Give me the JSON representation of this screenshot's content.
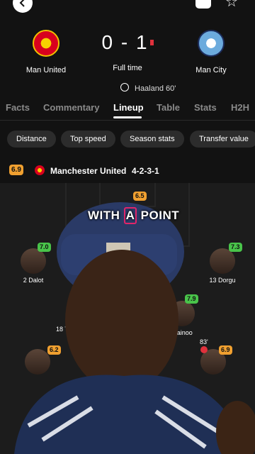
{
  "header": {
    "home_team": "Man United",
    "away_team": "Man City",
    "score": "0 - 1",
    "status": "Full time",
    "scorer": "Haaland 60'"
  },
  "tabs": [
    {
      "label": "Facts",
      "active": false
    },
    {
      "label": "Commentary",
      "active": false
    },
    {
      "label": "Lineup",
      "active": true
    },
    {
      "label": "Table",
      "active": false
    },
    {
      "label": "Stats",
      "active": false
    },
    {
      "label": "H2H",
      "active": false
    }
  ],
  "chips": [
    "Distance",
    "Top speed",
    "Season stats",
    "Transfer value"
  ],
  "lineup": {
    "team_rating": "6.9",
    "team_name": "Manchester United",
    "formation": "4-2-3-1"
  },
  "players": {
    "gk_rating": "6.5",
    "dalot_rating": "7.0",
    "dalot_name": "2 Dalot",
    "dorgu_rating": "7.3",
    "dorgu_name": "13 Dorgu",
    "mainoo_rating": "7.9",
    "mainoo_name": "Mainoo",
    "number_18": "18 T",
    "left_mid_rating": "6.2",
    "right_mid_rating": "6.9",
    "sub_time": "83'"
  },
  "overlay": {
    "caption_pre": "WITH ",
    "caption_box": "A",
    "caption_post": " POINT"
  },
  "colors": {
    "background": "#121212",
    "rating_orange": "#f0a030",
    "rating_green": "#49c44a",
    "red_card": "#e0313c",
    "caption_highlight": "#e0256a"
  },
  "icons": [
    "back-arrow-icon",
    "share-icon",
    "star-icon",
    "ball-icon",
    "red-card-icon",
    "substitution-icon"
  ]
}
